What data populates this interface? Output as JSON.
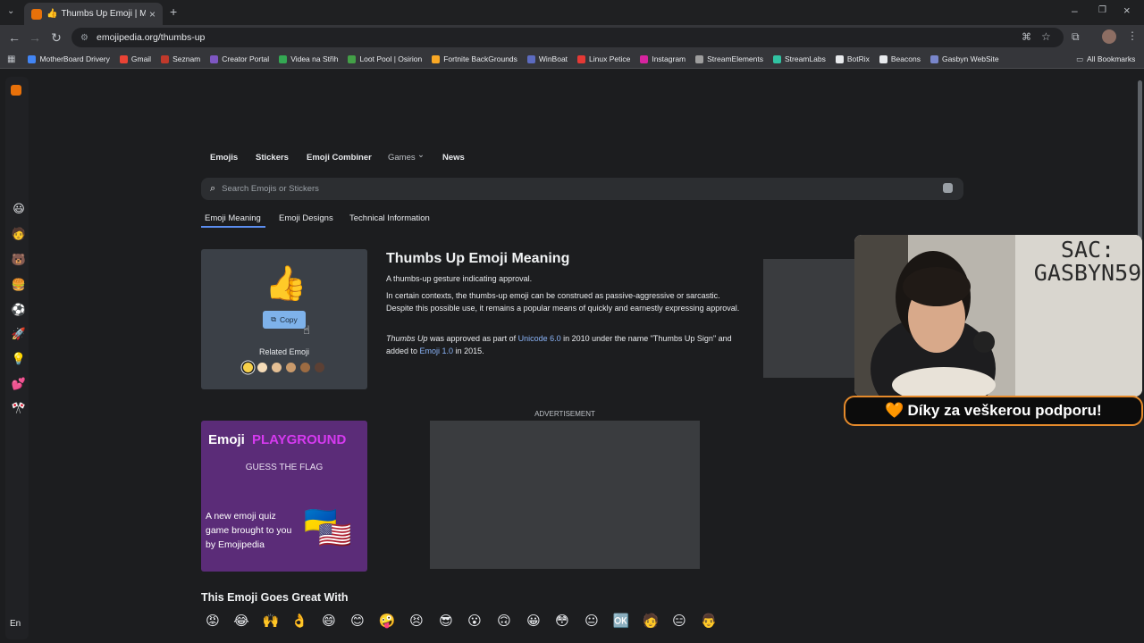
{
  "browser": {
    "tab_title": "Thumbs Up Emoji | Meaning",
    "tab_emoji": "👍",
    "new_tab": "+",
    "url": "emojipedia.org/thumbs-up",
    "bookmarks": [
      {
        "label": "MotherBoard Drivery",
        "color": "#4285f4"
      },
      {
        "label": "Gmail",
        "color": "#ea4335"
      },
      {
        "label": "Seznam",
        "color": "#c0392b"
      },
      {
        "label": "Creator Portal",
        "color": "#7e57c2"
      },
      {
        "label": "Videa na Střih",
        "color": "#34a853"
      },
      {
        "label": "Loot Pool | Osirion",
        "color": "#43a047"
      },
      {
        "label": "Fortnite BackGrounds",
        "color": "#f9a825"
      },
      {
        "label": "WinBoat",
        "color": "#5c6bc0"
      },
      {
        "label": "Linux Petice",
        "color": "#e53935"
      },
      {
        "label": "Instagram",
        "color": "#d6249f"
      },
      {
        "label": "StreamElements",
        "color": "#9e9e9e"
      },
      {
        "label": "StreamLabs",
        "color": "#31c3a2"
      },
      {
        "label": "BotRix",
        "color": "#e8eaed"
      },
      {
        "label": "Beacons",
        "color": "#e8eaed"
      },
      {
        "label": "Gasbyn WebSite",
        "color": "#7986cb"
      }
    ],
    "all_bookmarks": "All Bookmarks"
  },
  "rail": {
    "emojis": [
      "😃",
      "🧑",
      "🐻",
      "🍔",
      "⚽",
      "🚀",
      "💡",
      "💕",
      "🎌"
    ],
    "language": "En"
  },
  "nav": {
    "items": [
      "Emojis",
      "Stickers",
      "Emoji Combiner",
      "Games",
      "News"
    ],
    "games_chevron": "⌄"
  },
  "search": {
    "placeholder": "Search Emojis or Stickers"
  },
  "subtabs": [
    "Emoji Meaning",
    "Emoji Designs",
    "Technical Information"
  ],
  "card": {
    "emoji": "👍",
    "copy_label": "Copy",
    "related_label": "Related Emoji",
    "swatches": [
      "#f7d04a",
      "#f5dcb8",
      "#e4bf94",
      "#c99a6b",
      "#9c6b42",
      "#5c4034"
    ]
  },
  "article": {
    "title": "Thumbs Up Emoji Meaning",
    "p1": "A thumbs-up gesture indicating approval.",
    "p2": "In certain contexts, the thumbs-up emoji can be construed as passive-aggressive or sarcastic. Despite this possible use, it remains a popular means of quickly and earnestly expressing approval.",
    "p3_name": "Thumbs Up",
    "p3_a": " was approved as part of ",
    "p3_link1": "Unicode 6.0",
    "p3_b": " in 2010 under the name \"Thumbs Up Sign\" and added to ",
    "p3_link2": "Emoji 1.0",
    "p3_c": " in 2015."
  },
  "playground": {
    "brand_a": "Emoji",
    "brand_b": "PLAYGROUND",
    "subtitle": "GUESS THE FLAG",
    "desc": "A new emoji quiz game brought to you by Emojipedia",
    "flag_a": "🇺🇦",
    "flag_b": "🇺🇸"
  },
  "advertisement": "ADVERTISEMENT",
  "goes_great": {
    "title": "This Emoji Goes Great With",
    "emojis": [
      "😡",
      "😂",
      "🙌",
      "👌",
      "😄",
      "😊",
      "🤪",
      "😣",
      "😎",
      "😮",
      "🙃",
      "😀",
      "😳",
      "😐",
      "🆗",
      "🧑",
      "😑",
      "👨"
    ]
  },
  "overlay": {
    "cam_text": "SAC:\nGASBYN59",
    "banner_heart": "🧡",
    "banner": "Díky za veškerou podporu!"
  }
}
